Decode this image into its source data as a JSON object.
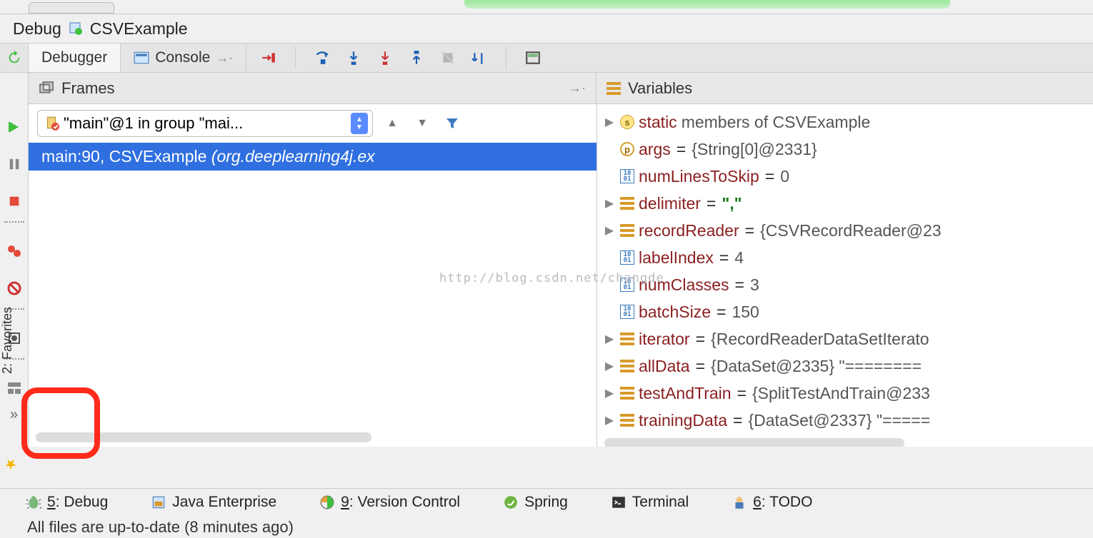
{
  "header": {
    "title": "Debug",
    "run_config": "CSVExample"
  },
  "tabs": {
    "debugger": "Debugger",
    "console": "Console"
  },
  "frames": {
    "title": "Frames",
    "thread": "\"main\"@1 in group \"mai...",
    "stack0_method": "main:90, CSVExample",
    "stack0_pkg": "(org.deeplearning4j.ex"
  },
  "variables": {
    "title": "Variables",
    "rows": [
      {
        "exp": true,
        "icon": "s",
        "name": "static",
        "suffix": " members of CSVExample",
        "val": ""
      },
      {
        "exp": false,
        "icon": "p",
        "name": "args",
        "val": "{String[0]@2331}"
      },
      {
        "exp": false,
        "icon": "bin",
        "name": "numLinesToSkip",
        "val": "0"
      },
      {
        "exp": true,
        "icon": "bars",
        "name": "delimiter",
        "val": "\",\"",
        "str": true
      },
      {
        "exp": true,
        "icon": "bars",
        "name": "recordReader",
        "val": "{CSVRecordReader@23"
      },
      {
        "exp": false,
        "icon": "bin",
        "name": "labelIndex",
        "val": "4"
      },
      {
        "exp": false,
        "icon": "bin",
        "name": "numClasses",
        "val": "3"
      },
      {
        "exp": false,
        "icon": "bin",
        "name": "batchSize",
        "val": "150"
      },
      {
        "exp": true,
        "icon": "bars",
        "name": "iterator",
        "val": "{RecordReaderDataSetIterato"
      },
      {
        "exp": true,
        "icon": "bars",
        "name": "allData",
        "val": "{DataSet@2335} \"========"
      },
      {
        "exp": true,
        "icon": "bars",
        "name": "testAndTrain",
        "val": "{SplitTestAndTrain@233"
      },
      {
        "exp": true,
        "icon": "bars",
        "name": "trainingData",
        "val": "{DataSet@2337} \"====="
      }
    ]
  },
  "bottom_tabs": {
    "debug": "Debug",
    "debug_key": "5",
    "java_ee": "Java Enterprise",
    "vcs": "Version Control",
    "vcs_key": "9",
    "spring": "Spring",
    "terminal": "Terminal",
    "todo": "TODO",
    "todo_key": "6"
  },
  "favorites_label": "2: Favorites",
  "status": "All files are up-to-date (8 minutes ago)",
  "watermark": "http://blog.csdn.net/changde"
}
